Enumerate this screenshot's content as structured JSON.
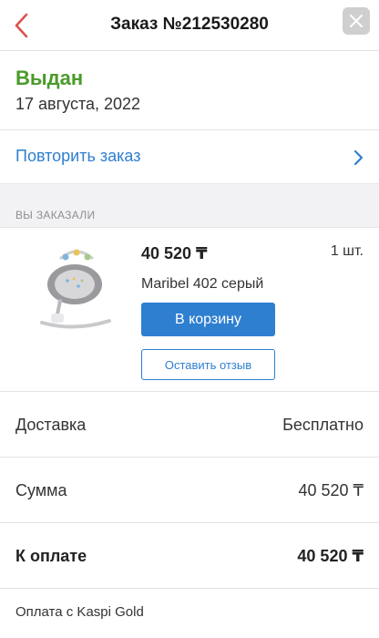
{
  "header": {
    "title": "Заказ №212530280",
    "back_icon": "chevron-left-icon",
    "close_icon": "close-icon",
    "accent_color": "#d9534f"
  },
  "order_status": {
    "status": "Выдан",
    "status_color": "#4a9a2a",
    "date": "17 августа, 2022"
  },
  "repeat_order": {
    "label": "Повторить заказ",
    "icon": "chevron-right-icon",
    "color": "#2e7fd0"
  },
  "section": {
    "ordered_label": "ВЫ ЗАКАЗАЛИ"
  },
  "product": {
    "price": "40 520 ₸",
    "quantity": "1 шт.",
    "name": "Maribel 402 серый",
    "add_to_cart_label": "В корзину",
    "leave_review_label": "Оставить отзыв",
    "image_icon": "baby-swing-product-image"
  },
  "summary": {
    "delivery_label": "Доставка",
    "delivery_value": "Бесплатно",
    "sum_label": "Сумма",
    "sum_value": "40 520 ₸",
    "total_label": "К оплате",
    "total_value": "40 520 ₸"
  },
  "payment": {
    "method": "Оплата с Kaspi Gold"
  }
}
